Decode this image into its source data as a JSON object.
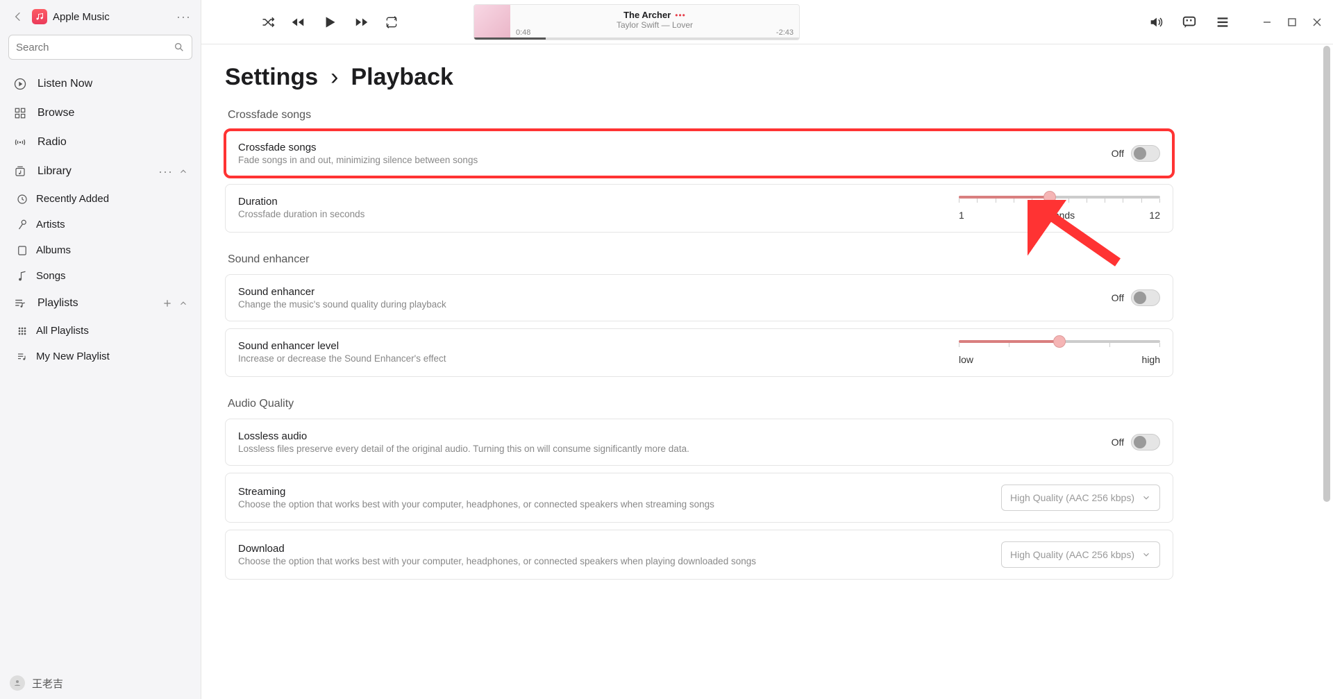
{
  "app": {
    "title": "Apple Music"
  },
  "search": {
    "placeholder": "Search"
  },
  "sidebar": {
    "listen_now": "Listen Now",
    "browse": "Browse",
    "radio": "Radio",
    "library": "Library",
    "recently_added": "Recently Added",
    "artists": "Artists",
    "albums": "Albums",
    "songs": "Songs",
    "playlists": "Playlists",
    "all_playlists": "All Playlists",
    "my_new_playlist": "My New Playlist"
  },
  "user": {
    "name": "王老吉"
  },
  "now_playing": {
    "title": "The Archer",
    "subtitle": "Taylor Swift — Lover",
    "elapsed": "0:48",
    "remaining": "-2:43",
    "progress_percent": 22
  },
  "breadcrumb": {
    "root": "Settings",
    "sep": "›",
    "leaf": "Playback"
  },
  "sections": {
    "crossfade": {
      "title": "Crossfade songs",
      "row_title": "Crossfade songs",
      "row_desc": "Fade songs in and out, minimizing silence between songs",
      "toggle_state": "Off",
      "duration_title": "Duration",
      "duration_desc": "Crossfade duration in seconds",
      "slider_min": "1",
      "slider_center": "seconds",
      "slider_max": "12",
      "slider_value_percent": 45
    },
    "enhancer": {
      "title": "Sound enhancer",
      "row_title": "Sound enhancer",
      "row_desc": "Change the music's sound quality during playback",
      "toggle_state": "Off",
      "level_title": "Sound enhancer level",
      "level_desc": "Increase or decrease the Sound Enhancer's effect",
      "slider_min": "low",
      "slider_max": "high",
      "slider_value_percent": 50
    },
    "audio_quality": {
      "title": "Audio Quality",
      "lossless_title": "Lossless audio",
      "lossless_desc": "Lossless files preserve every detail of the original audio. Turning this on will consume significantly more data.",
      "lossless_toggle": "Off",
      "streaming_title": "Streaming",
      "streaming_desc": "Choose the option that works best with your computer, headphones, or connected speakers when streaming songs",
      "streaming_value": "High Quality (AAC 256 kbps)",
      "download_title": "Download",
      "download_desc": "Choose the option that works best with your computer, headphones, or connected speakers when playing downloaded songs",
      "download_value": "High Quality (AAC 256 kbps)"
    }
  }
}
